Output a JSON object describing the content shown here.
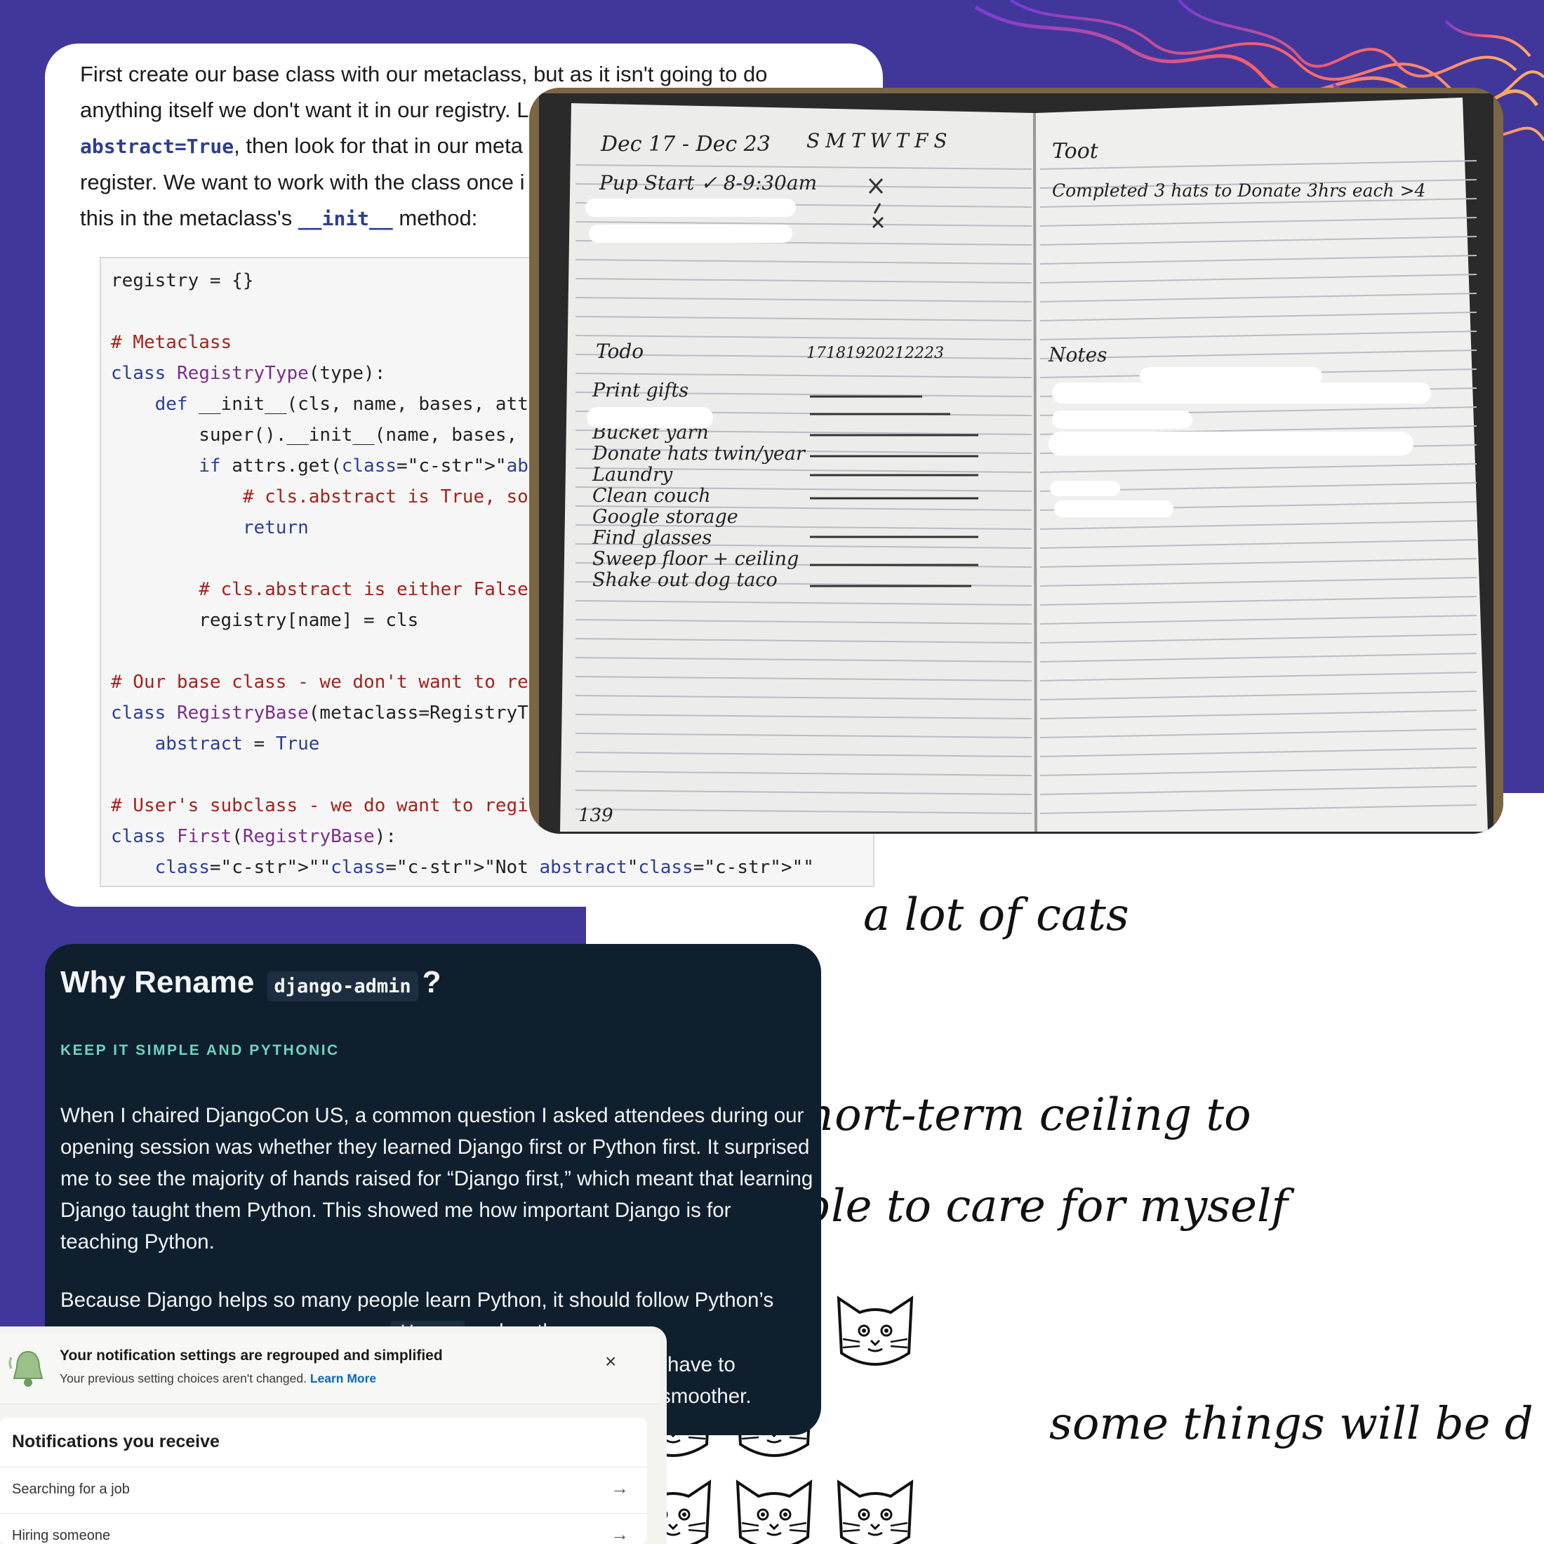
{
  "code_card": {
    "intro_1": "First create our base class with our metaclass, but as it isn't going to do",
    "intro_2": "anything itself we don't want it in our registry. L",
    "intro_3_code": "abstract=True",
    "intro_3": ", then look for that in our meta",
    "intro_4": "register. We want to work with the class once i",
    "intro_5_a": "this in the metaclass's ",
    "intro_5_code": "__init__",
    "intro_5_b": " method:",
    "code_lines": [
      "registry = {}",
      "",
      "# Metaclass",
      "class RegistryType(type):",
      "    def __init__(cls, name, bases, att",
      "        super().__init__(name, bases,",
      "        if attrs.get(\"abstract\", False",
      "            # cls.abstract is True, so",
      "            return",
      "",
      "        # cls.abstract is either False",
      "        registry[name] = cls",
      "",
      "# Our base class - we don't want to re",
      "class RegistryBase(metaclass=RegistryT",
      "    abstract = True",
      "",
      "# User's subclass - we do want to regi",
      "class First(RegistryBase):",
      "    \"\"\"Not abstract\"\"\""
    ]
  },
  "notebook": {
    "left_header": "Dec 17 - Dec 23",
    "weekdays": "SMTWTFS",
    "left_item_1": "Pup Start ✓ 8-9:30am",
    "todo_heading": "Todo",
    "todo_dates": "17181920212223",
    "todo_items": [
      "Print gifts",
      "Bucket yarn",
      "Donate hats twin/year",
      "Laundry",
      "Clean couch",
      "Google storage",
      "Find glasses",
      "Sweep floor + ceiling",
      "Shake out dog taco"
    ],
    "right_header": "Toot",
    "right_line": "Completed 3 hats to Donate 3hrs each >4",
    "notes_heading": "Notes",
    "page_number": "139"
  },
  "cats_panel": {
    "line_1": "a lot of cats",
    "line_2": "short-term ceiling to",
    "line_3": "able to care for myself",
    "line_4": "some things will be d"
  },
  "django_card": {
    "title_a": "Why Rename",
    "title_code": "django-admin",
    "title_b": "?",
    "kicker": "KEEP IT SIMPLE AND PYTHONIC",
    "para_1": "When I chaired DjangoCon US, a common question I asked attendees during our opening session was whether they learned Django first or Python first. It surprised me to see the majority of hands raised for “Django first,” which meant that learning Django taught them Python. This showed me how important Django is for teaching Python.",
    "para_2_a": "Because Django helps so many people learn Python, it should follow Python’s",
    "para_2_line2_visible": "makes the",
    "para_2_line2_code": "django",
    "para_2_line3_visible": "have to",
    "para_2_line4_visible": "smoother."
  },
  "notification": {
    "title": "Your notification settings are regrouped and simplified",
    "subtitle": "Your previous setting choices aren't changed.",
    "learn_more": "Learn More",
    "close_label": "×",
    "list_heading": "Notifications you receive",
    "rows": [
      "Searching for a job",
      "Hiring someone"
    ],
    "arrow": "→"
  }
}
